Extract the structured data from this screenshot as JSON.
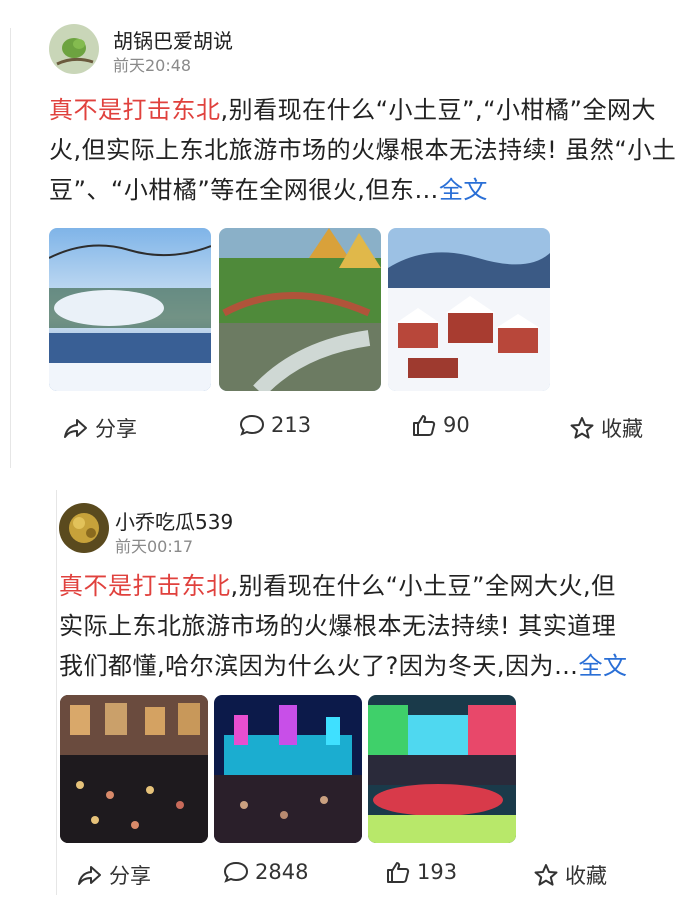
{
  "posts": [
    {
      "username": "胡锅巴爱胡说",
      "time": "前天20:48",
      "text_highlight": "真不是打击东北",
      "text_body": ",别看现在什么“小土豆”,“小柑橘”全网大火,但实际上东北旅游市场的火爆根本无法持续! 虽然“小土豆”、“小柑橘”等在全网很火,但东…",
      "more_label": "全文",
      "images": [
        "winter-lake-photo",
        "autumn-bridge-photo",
        "snow-village-photo"
      ],
      "actions": {
        "share": "分享",
        "comments": "213",
        "likes": "90",
        "favorite": "收藏"
      }
    },
    {
      "username": "小乔吃瓜539",
      "time": "前天00:17",
      "text_highlight": "真不是打击东北",
      "text_body": ",别看现在什么“小土豆”全网大火,但实际上东北旅游市场的火爆根本无法持续! 其实道理我们都懂,哈尔滨因为什么火了?因为冬天,因为…",
      "more_label": "全文",
      "images": [
        "night-crowd-street-photo",
        "ice-castle-night-photo",
        "ice-world-colorful-photo"
      ],
      "actions": {
        "share": "分享",
        "comments": "2848",
        "likes": "193",
        "favorite": "收藏"
      }
    }
  ],
  "colors": {
    "highlight": "#e0413d",
    "link": "#2a6fd6",
    "meta": "#8a8a8a"
  }
}
